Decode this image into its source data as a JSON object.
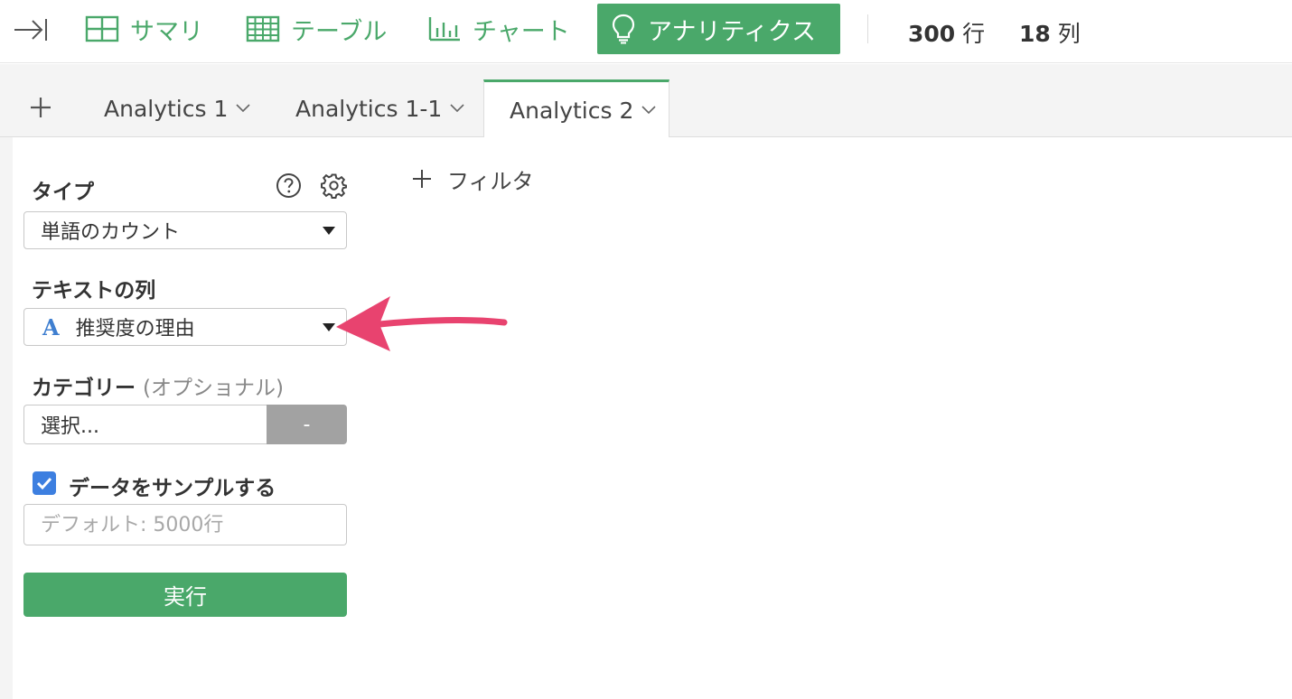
{
  "toolbar": {
    "summary_label": "サマリ",
    "table_label": "テーブル",
    "chart_label": "チャート",
    "analytics_label": "アナリティクス",
    "rows_value": "300",
    "rows_unit": "行",
    "cols_value": "18",
    "cols_unit": "列"
  },
  "tabs": [
    {
      "label": "Analytics 1"
    },
    {
      "label": "Analytics 1-1"
    },
    {
      "label": "Analytics 2"
    }
  ],
  "form": {
    "type_label": "タイプ",
    "type_value": "単語のカウント",
    "text_col_label": "テキストの列",
    "text_col_type_icon": "A",
    "text_col_value": "推奨度の理由",
    "category_label": "カテゴリー",
    "category_optional": "(オプショナル)",
    "category_value": "選択...",
    "category_button": "-",
    "sample_label": "データをサンプルする",
    "sample_checked": true,
    "sample_placeholder": "デフォルト: 5000行",
    "run_label": "実行"
  },
  "filter": {
    "label": "フィルタ"
  },
  "colors": {
    "accent": "#4aa86a",
    "checkbox": "#3d7fe0",
    "annotation_arrow": "#e8436f"
  }
}
